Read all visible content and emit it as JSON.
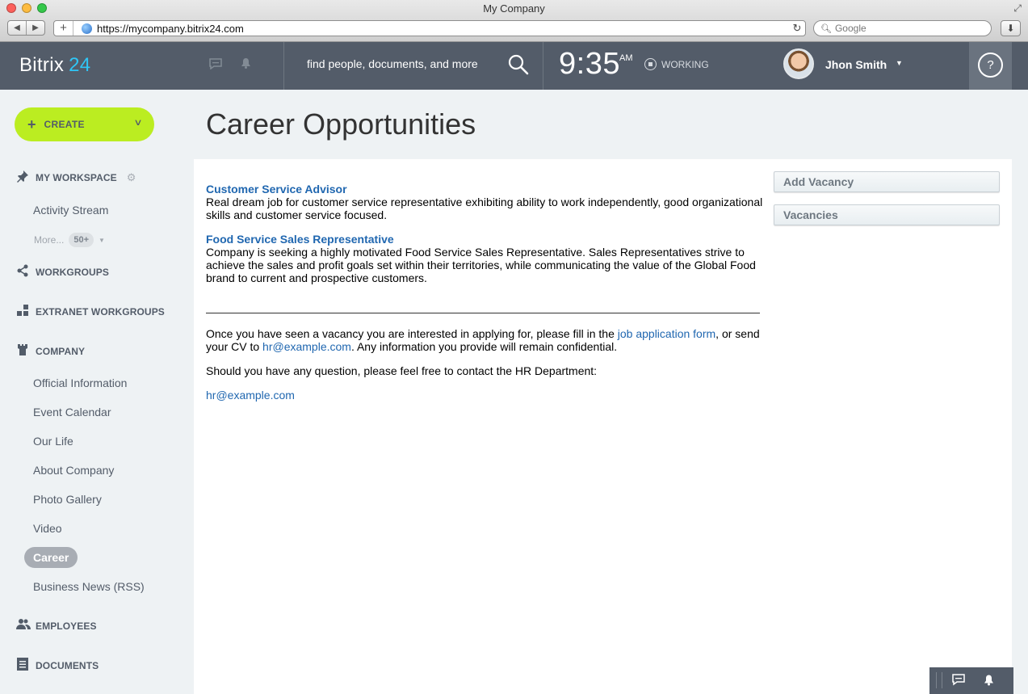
{
  "browser": {
    "window_title": "My Company",
    "url": "https://mycompany.bitrix24.com",
    "search_placeholder": "Google"
  },
  "header": {
    "logo_text": "Bitrix",
    "logo_num": "24",
    "search_placeholder": "find people, documents, and more",
    "time": "9:35",
    "ampm": "AM",
    "status": "WORKING",
    "user_name": "Jhon Smith",
    "help": "?"
  },
  "sidebar": {
    "create_label": "CREATE",
    "my_workspace": "MY WORKSPACE",
    "activity_stream": "Activity Stream",
    "more_label": "More...",
    "more_count": "50+",
    "workgroups": "WORKGROUPS",
    "extranet_workgroups": "EXTRANET WORKGROUPS",
    "company": "COMPANY",
    "company_items": [
      "Official Information",
      "Event Calendar",
      "Our Life",
      "About Company",
      "Photo Gallery",
      "Video",
      "Career",
      "Business News (RSS)"
    ],
    "employees": "EMPLOYEES",
    "documents": "DOCUMENTS"
  },
  "main": {
    "page_title": "Career Opportunities",
    "jobs": [
      {
        "title": "Customer Service Advisor",
        "description": "Real dream job for customer service representative exhibiting ability to work independently, good organizational skills and customer service focused."
      },
      {
        "title": "Food Service Sales Representative",
        "description": "Company is seeking a highly motivated Food Service Sales Representative. Sales Representatives strive to achieve the sales and profit goals set within their territories, while communicating the value of the Global Food brand to current and prospective customers."
      }
    ],
    "apply_text_1": "Once you have seen a vacancy you are interested in applying for, please fill in the ",
    "apply_link": "job application form",
    "apply_text_2": ", or send your CV to ",
    "apply_email": "hr@example.com",
    "apply_text_3": ". Any information you provide will remain confidential.",
    "contact_text": "Should you have any question, please feel free to contact the HR Department:",
    "contact_email": "hr@example.com",
    "add_vacancy": "Add Vacancy",
    "vacancies": "Vacancies"
  }
}
